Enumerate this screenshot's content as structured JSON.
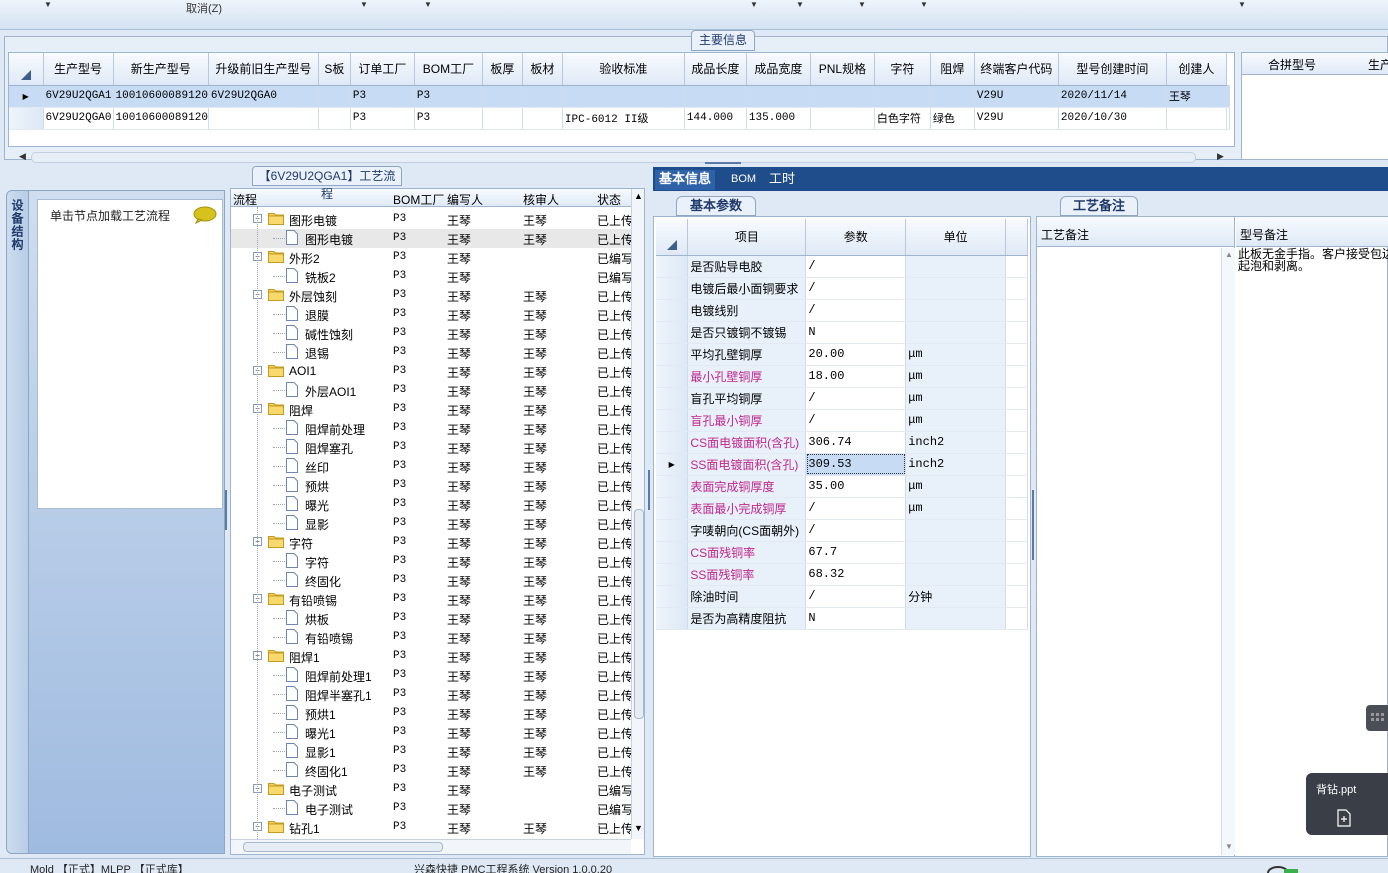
{
  "toolbar": {
    "cancel_label": "取消(Z)"
  },
  "main_info": {
    "tab_label": "主要信息",
    "columns": [
      "生产型号",
      "新生产型号",
      "升级前旧生产型号",
      "S板",
      "订单工厂",
      "BOM工厂",
      "板厚",
      "板材",
      "验收标准",
      "成品长度",
      "成品宽度",
      "PNL规格",
      "字符",
      "阻焊",
      "终端客户代码",
      "型号创建时间",
      "创建人"
    ],
    "rows": [
      [
        "6V29U2QGA1",
        "10010600089120",
        "6V29U2QGA0",
        "",
        "P3",
        "P3",
        "",
        "",
        "",
        "",
        "",
        "",
        "",
        "",
        "V29U",
        "2020/11/14",
        "王琴"
      ],
      [
        "6V29U2QGA0",
        "10010600089120",
        "",
        "",
        "P3",
        "P3",
        "",
        "",
        "IPC-6012 II级",
        "144.000",
        "135.000",
        "",
        "白色字符",
        "绿色",
        "V29U",
        "2020/10/30",
        ""
      ]
    ],
    "merge_header": "合拼型号",
    "merge_header2": "生产"
  },
  "side": {
    "tab_label": "设备结构",
    "hint": "单击节点加载工艺流程"
  },
  "process": {
    "tab_label": "【6V29U2QGA1】工艺流程",
    "columns": {
      "flow": "流程",
      "bom": "BOM工厂",
      "writer": "编写人",
      "reviewer": "核审人",
      "status": "状态"
    },
    "rows": [
      {
        "name": "图形电镀",
        "level": 0,
        "bom": "P3",
        "writer": "王琴",
        "reviewer": "王琴",
        "status": "已上传"
      },
      {
        "name": "图形电镀",
        "level": 1,
        "bom": "P3",
        "writer": "王琴",
        "reviewer": "王琴",
        "status": "已上传"
      },
      {
        "name": "外形2",
        "level": 0,
        "bom": "P3",
        "writer": "王琴",
        "reviewer": "",
        "status": "已编写"
      },
      {
        "name": "铣板2",
        "level": 1,
        "bom": "P3",
        "writer": "王琴",
        "reviewer": "",
        "status": "已编写"
      },
      {
        "name": "外层蚀刻",
        "level": 0,
        "bom": "P3",
        "writer": "王琴",
        "reviewer": "王琴",
        "status": "已上传"
      },
      {
        "name": "退膜",
        "level": 1,
        "bom": "P3",
        "writer": "王琴",
        "reviewer": "王琴",
        "status": "已上传"
      },
      {
        "name": "碱性蚀刻",
        "level": 1,
        "bom": "P3",
        "writer": "王琴",
        "reviewer": "王琴",
        "status": "已上传"
      },
      {
        "name": "退锡",
        "level": 1,
        "bom": "P3",
        "writer": "王琴",
        "reviewer": "王琴",
        "status": "已上传"
      },
      {
        "name": "AOI1",
        "level": 0,
        "bom": "P3",
        "writer": "王琴",
        "reviewer": "王琴",
        "status": "已上传"
      },
      {
        "name": "外层AOI1",
        "level": 1,
        "bom": "P3",
        "writer": "王琴",
        "reviewer": "王琴",
        "status": "已上传"
      },
      {
        "name": "阻焊",
        "level": 0,
        "bom": "P3",
        "writer": "王琴",
        "reviewer": "王琴",
        "status": "已上传"
      },
      {
        "name": "阻焊前处理",
        "level": 1,
        "bom": "P3",
        "writer": "王琴",
        "reviewer": "王琴",
        "status": "已上传"
      },
      {
        "name": "阻焊塞孔",
        "level": 1,
        "bom": "P3",
        "writer": "王琴",
        "reviewer": "王琴",
        "status": "已上传"
      },
      {
        "name": "丝印",
        "level": 1,
        "bom": "P3",
        "writer": "王琴",
        "reviewer": "王琴",
        "status": "已上传"
      },
      {
        "name": "预烘",
        "level": 1,
        "bom": "P3",
        "writer": "王琴",
        "reviewer": "王琴",
        "status": "已上传"
      },
      {
        "name": "曝光",
        "level": 1,
        "bom": "P3",
        "writer": "王琴",
        "reviewer": "王琴",
        "status": "已上传"
      },
      {
        "name": "显影",
        "level": 1,
        "bom": "P3",
        "writer": "王琴",
        "reviewer": "王琴",
        "status": "已上传"
      },
      {
        "name": "字符",
        "level": 0,
        "bom": "P3",
        "writer": "王琴",
        "reviewer": "王琴",
        "status": "已上传"
      },
      {
        "name": "字符",
        "level": 1,
        "bom": "P3",
        "writer": "王琴",
        "reviewer": "王琴",
        "status": "已上传"
      },
      {
        "name": "终固化",
        "level": 1,
        "bom": "P3",
        "writer": "王琴",
        "reviewer": "王琴",
        "status": "已上传"
      },
      {
        "name": "有铅喷锡",
        "level": 0,
        "bom": "P3",
        "writer": "王琴",
        "reviewer": "王琴",
        "status": "已上传"
      },
      {
        "name": "烘板",
        "level": 1,
        "bom": "P3",
        "writer": "王琴",
        "reviewer": "王琴",
        "status": "已上传"
      },
      {
        "name": "有铅喷锡",
        "level": 1,
        "bom": "P3",
        "writer": "王琴",
        "reviewer": "王琴",
        "status": "已上传"
      },
      {
        "name": "阻焊1",
        "level": 0,
        "bom": "P3",
        "writer": "王琴",
        "reviewer": "王琴",
        "status": "已上传"
      },
      {
        "name": "阻焊前处理1",
        "level": 1,
        "bom": "P3",
        "writer": "王琴",
        "reviewer": "王琴",
        "status": "已上传"
      },
      {
        "name": "阻焊半塞孔1",
        "level": 1,
        "bom": "P3",
        "writer": "王琴",
        "reviewer": "王琴",
        "status": "已上传"
      },
      {
        "name": "预烘1",
        "level": 1,
        "bom": "P3",
        "writer": "王琴",
        "reviewer": "王琴",
        "status": "已上传"
      },
      {
        "name": "曝光1",
        "level": 1,
        "bom": "P3",
        "writer": "王琴",
        "reviewer": "王琴",
        "status": "已上传"
      },
      {
        "name": "显影1",
        "level": 1,
        "bom": "P3",
        "writer": "王琴",
        "reviewer": "王琴",
        "status": "已上传"
      },
      {
        "name": "终固化1",
        "level": 1,
        "bom": "P3",
        "writer": "王琴",
        "reviewer": "王琴",
        "status": "已上传"
      },
      {
        "name": "电子测试",
        "level": 0,
        "bom": "P3",
        "writer": "王琴",
        "reviewer": "",
        "status": "已编写"
      },
      {
        "name": "电子测试",
        "level": 1,
        "bom": "P3",
        "writer": "王琴",
        "reviewer": "",
        "status": "已编写"
      },
      {
        "name": "钻孔1",
        "level": 0,
        "bom": "P3",
        "writer": "王琴",
        "reviewer": "王琴",
        "status": "已上传"
      }
    ]
  },
  "info_tabs": [
    "基本信息",
    "BOM",
    "工时"
  ],
  "basic_params": {
    "tab_label": "基本参数",
    "columns": [
      "项目",
      "参数",
      "单位"
    ],
    "rows": [
      {
        "item": "是否贴导电胶",
        "value": "/",
        "unit": "",
        "highlight": false
      },
      {
        "item": "电镀后最小面铜要求",
        "value": "/",
        "unit": "",
        "highlight": false
      },
      {
        "item": "电镀线别",
        "value": "/",
        "unit": "",
        "highlight": false
      },
      {
        "item": "是否只镀铜不镀锡",
        "value": "N",
        "unit": "",
        "highlight": false
      },
      {
        "item": "平均孔壁铜厚",
        "value": "20.00",
        "unit": "μm",
        "highlight": false
      },
      {
        "item": "最小孔壁铜厚",
        "value": "18.00",
        "unit": "μm",
        "highlight": true
      },
      {
        "item": "盲孔平均铜厚",
        "value": "/",
        "unit": "μm",
        "highlight": false
      },
      {
        "item": "盲孔最小铜厚",
        "value": "/",
        "unit": "μm",
        "highlight": true
      },
      {
        "item": "CS面电镀面积(含孔)",
        "value": "306.74",
        "unit": "inch2",
        "highlight": true
      },
      {
        "item": "SS面电镀面积(含孔)",
        "value": "309.53",
        "unit": "inch2",
        "highlight": true
      },
      {
        "item": "表面完成铜厚度",
        "value": "35.00",
        "unit": "μm",
        "highlight": true
      },
      {
        "item": "表面最小完成铜厚",
        "value": "/",
        "unit": "μm",
        "highlight": true
      },
      {
        "item": "字唛朝向(CS面朝外)",
        "value": "/",
        "unit": "",
        "highlight": false
      },
      {
        "item": "CS面残铜率",
        "value": "67.7",
        "unit": "",
        "highlight": true
      },
      {
        "item": "SS面残铜率",
        "value": "68.32",
        "unit": "",
        "highlight": true
      },
      {
        "item": "除油时间",
        "value": "/",
        "unit": "分钟",
        "highlight": false
      },
      {
        "item": "是否为高精度阻抗",
        "value": "N",
        "unit": "",
        "highlight": false
      }
    ],
    "selected_row": 9
  },
  "process_notes": {
    "tab_label": "工艺备注",
    "col_notes": "工艺备注",
    "col_model_notes": "型号备注",
    "model_note_text": "此板无金手指。客户接受包边\n起泡和剥离。"
  },
  "float_card": {
    "file_name": "背钻.ppt"
  },
  "statusbar": {
    "left": "Mold 【正式】MLPP 【正式库】",
    "center": "兴森快捷 PMC工程系统 Version 1.0.0.20"
  },
  "colors": {
    "accent": "#1f4c8a",
    "highlight_text": "#c0268c",
    "selection": "#c7dcf4"
  }
}
